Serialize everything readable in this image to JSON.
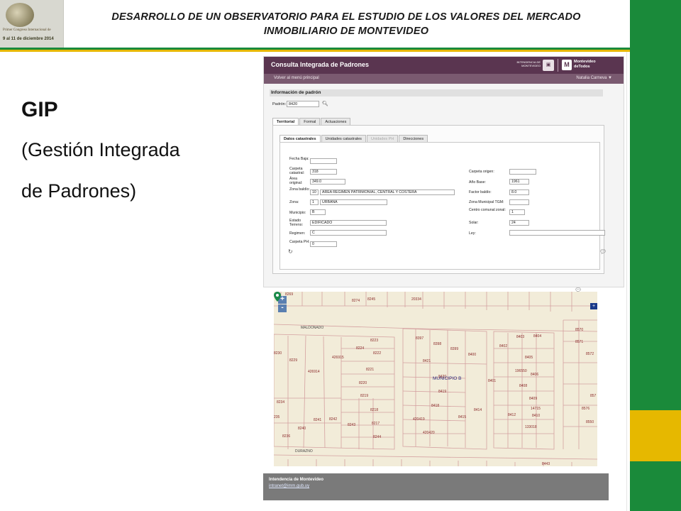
{
  "slide": {
    "title_line1": "DESARROLLO  DE  UN  OBSERVATORIO  PARA  EL  ESTUDIO  DE  LOS  VALORES  DEL  MERCADO",
    "title_line2": "INMOBILIARIO  DE  MONTEVIDEO",
    "heading": "GIP",
    "subheading_line1": "(Gestión Integrada",
    "subheading_line2": "de Padrones)",
    "logo_line1": "Primer Congreso Internacional de",
    "logo_line2": "9 al 11 de diciembre 2014",
    "colors": {
      "green": "#1a8a3a",
      "yellow": "#e6b800",
      "app_purple": "#5a3550"
    }
  },
  "app": {
    "title": "Consulta Integrada de Padrones",
    "intendencia_logo": "INTENDENCIA DE MONTEVIDEO",
    "brand_mark": "M",
    "brand": "Montevideo deTodos",
    "nav_back": "Volver al menú principal",
    "nav_user": "Natalia Carneva ▼",
    "section_title": "Información de padrón",
    "padron_label": "Padrón:",
    "padron_value": "8420",
    "search_icon": "search-icon",
    "tabs": [
      "Territorial",
      "Formal",
      "Actuaciones"
    ],
    "subtabs": [
      "Datos catastrales",
      "Unidades catastrales",
      "Unidades PH",
      "Direcciones"
    ],
    "fields": {
      "fecha_baja": {
        "label": "Fecha Baja:",
        "value": ""
      },
      "carpeta_catastral": {
        "label": "Carpeta catastral:",
        "value": "318"
      },
      "area_original": {
        "label": "Área original:",
        "value": "349.0"
      },
      "zona_baldio": {
        "label": "Zona baldío:",
        "code": "10",
        "value": "AREA REGIMEN PATRIMONIAL, CENTRAL Y COSTERA"
      },
      "zona": {
        "label": "Zona:",
        "code": "1",
        "value": "URBANA"
      },
      "municipio": {
        "label": "Municipio:",
        "value": "B"
      },
      "estado_terreno": {
        "label": "Estado Terreno:",
        "value": "EDIFICADO"
      },
      "regimen": {
        "label": "Regimen:",
        "value": "C"
      },
      "carpeta_ph": {
        "label": "Carpeta PH:",
        "value": "0"
      },
      "carpeta_origen": {
        "label": "Carpeta origen:",
        "value": ""
      },
      "anio_base": {
        "label": "Año Base:",
        "value": "1961"
      },
      "factor_baldio": {
        "label": "Factor baldío:",
        "value": "8.0"
      },
      "zona_municipal": {
        "label": "Zona Municipal TGM:",
        "value": ""
      },
      "centro_comunal": {
        "label": "Centro comunal zonal:",
        "value": "1"
      },
      "solar": {
        "label": "Solar:",
        "value": "24"
      },
      "ley": {
        "label": "Ley:",
        "value": ""
      }
    }
  },
  "map": {
    "zoom_in": "+",
    "zoom_out": "-",
    "layer_button": "+",
    "streets": [
      "MALDONADO",
      "DURAZNO"
    ],
    "municipio_label": "MUNICIPIO B",
    "parcels": [
      "8269",
      "8274",
      "8245",
      "20334",
      "8223",
      "8224",
      "8222",
      "426915",
      "8229",
      "8230",
      "8221",
      "426914",
      "8220",
      "8219",
      "8218",
      "8217",
      "8234",
      "8241",
      "8242",
      "8243",
      "8240",
      "8244",
      "8236",
      "235",
      "8397",
      "8398",
      "8399",
      "8400",
      "8421",
      "8420",
      "8419",
      "8418",
      "420419",
      "420420",
      "8415",
      "8414",
      "8401",
      "8402",
      "8403",
      "8404",
      "8405",
      "8406",
      "8408",
      "8409",
      "8410",
      "8412",
      "14715",
      "133018",
      "196550",
      "8570",
      "8571",
      "8572",
      "857",
      "8576",
      "8550",
      "8443"
    ]
  },
  "footer": {
    "org": "Intendencia de Montevideo",
    "link": "intranet@imm.gub.uy"
  }
}
